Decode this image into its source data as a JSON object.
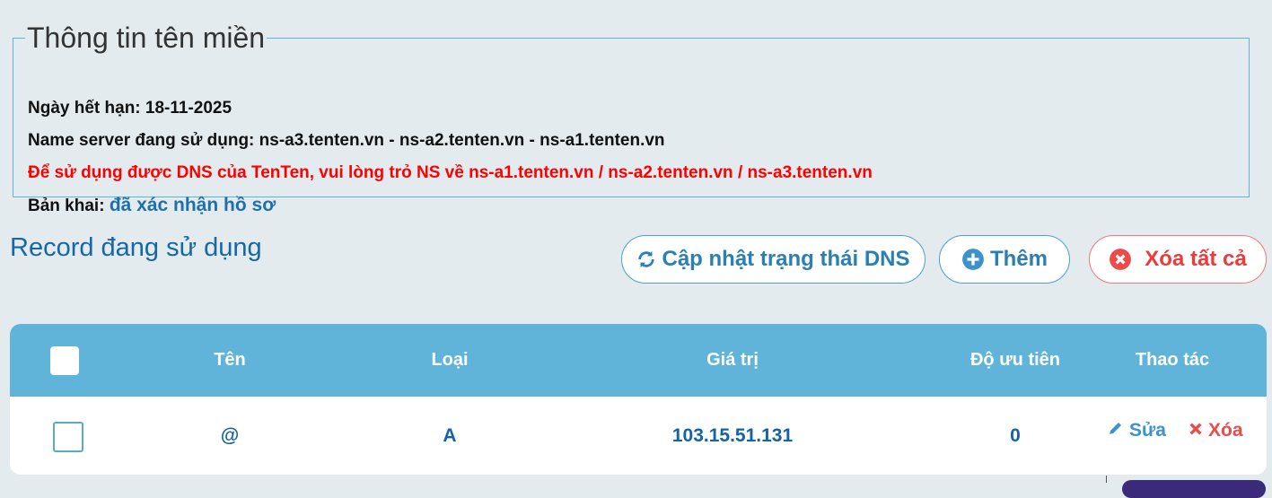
{
  "domain_info": {
    "legend": "Thông tin tên miền",
    "expiry": "Ngày hết hạn: 18-11-2025",
    "nameservers": "Name server đang sử dụng: ns-a3.tenten.vn - ns-a2.tenten.vn - ns-a1.tenten.vn",
    "warning": "Để sử dụng được DNS của TenTen, vui lòng trỏ NS về ns-a1.tenten.vn / ns-a2.tenten.vn / ns-a3.tenten.vn",
    "declaration_label": "Bản khai:",
    "declaration_status": "đã xác nhận hồ sơ"
  },
  "records": {
    "title": "Record đang sử dụng",
    "buttons": {
      "refresh": "Cập nhật trạng thái DNS",
      "add": "Thêm",
      "delete_all": "Xóa tất cả"
    },
    "columns": [
      "Tên",
      "Loại",
      "Giá trị",
      "Độ ưu tiên",
      "Thao tác"
    ],
    "rows": [
      {
        "name": "@",
        "type": "A",
        "value": "103.15.51.131",
        "priority": "0",
        "edit": "Sửa",
        "delete": "Xóa"
      }
    ]
  },
  "colors": {
    "accent": "#1567a8",
    "header": "#60b3d9",
    "warning": "#ff0000",
    "danger": "#ee3a3a"
  },
  "icons": [
    "refresh-icon",
    "plus-circle-icon",
    "close-circle-icon",
    "pencil-icon",
    "x-icon"
  ]
}
